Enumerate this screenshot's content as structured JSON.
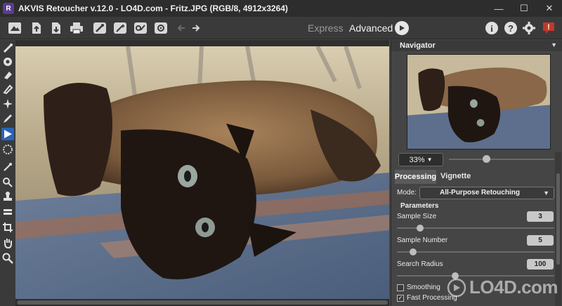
{
  "window": {
    "title": "AKVIS Retoucher v.12.0 - LO4D.com - Fritz.JPG (RGB/8, 4912x3264)",
    "app_icon_letter": "R",
    "minimize": "—",
    "maximize": "☐",
    "close": "✕"
  },
  "toolbar": {
    "buttons": [
      "home-icon",
      "open-icon",
      "save-icon",
      "print-icon",
      "brush-icon",
      "wand-icon",
      "settings-brush-icon",
      "gear-icon",
      "back-arrow-icon",
      "forward-arrow-icon"
    ],
    "mode_express": "Express",
    "mode_advanced": "Advanced",
    "right_icons": [
      "info-icon",
      "help-icon",
      "settings-icon",
      "notification-icon"
    ],
    "help_label": "?",
    "info_label": "i",
    "alert_label": "!"
  },
  "left_tools": [
    "retouch-brush",
    "healing",
    "eraser",
    "patch",
    "magic",
    "pencil",
    "run",
    "spot",
    "brush-small",
    "clone",
    "stamp",
    "chain",
    "crop",
    "hand",
    "zoom"
  ],
  "navigator": {
    "title": "Navigator"
  },
  "zoom": {
    "value": "33%",
    "level": 0.33
  },
  "tabs": {
    "processing": "Processing",
    "vignette": "Vignette"
  },
  "mode": {
    "label": "Mode:",
    "value": "All-Purpose Retouching"
  },
  "parameters": {
    "title": "Parameters",
    "sample_size": {
      "label": "Sample Size",
      "value": "3"
    },
    "sample_number": {
      "label": "Sample Number",
      "value": "5"
    },
    "search_radius": {
      "label": "Search Radius",
      "value": "100"
    }
  },
  "checkboxes": {
    "smoothing": {
      "label": "Smoothing",
      "checked": false
    },
    "fast_processing": {
      "label": "Fast Processing",
      "checked": true,
      "mark": "✓"
    }
  },
  "watermark": "LO4D.com",
  "colors": {
    "titlebar": "#2d2d2d",
    "panel": "#454545",
    "accent_run": "#e6e6e6",
    "alert": "#c0392b"
  }
}
